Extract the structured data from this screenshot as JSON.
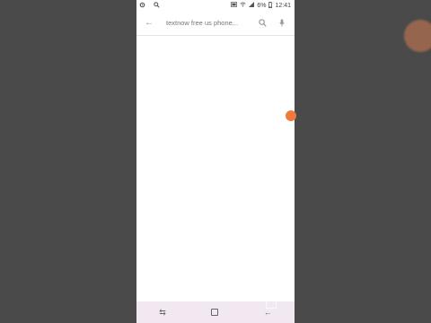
{
  "status": {
    "battery": "6%",
    "time": "12:41"
  },
  "search": {
    "query": "textnow free us phone..."
  },
  "floating": {
    "label": ""
  }
}
